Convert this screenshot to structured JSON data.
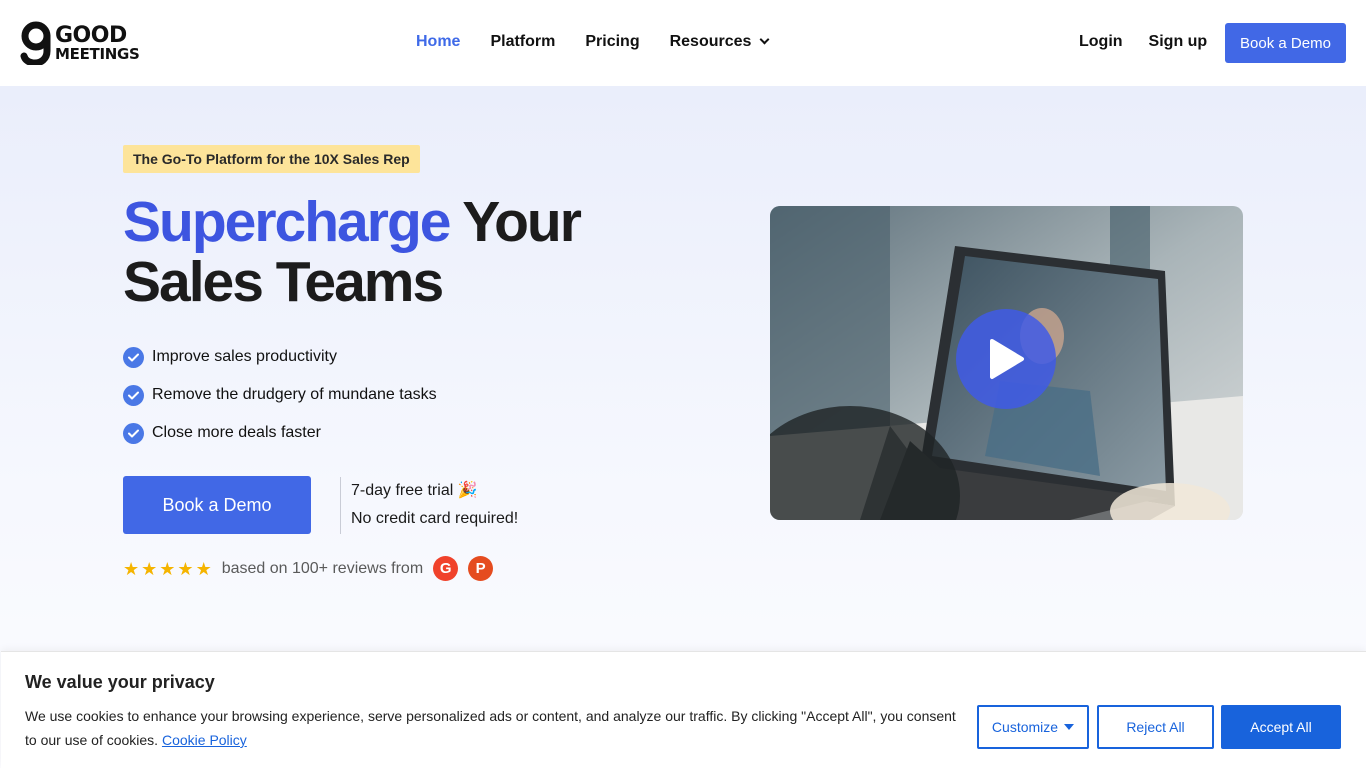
{
  "brand": {
    "logo_line1": "GOOD",
    "logo_line2": "MEETINGS"
  },
  "nav": {
    "items": [
      {
        "label": "Home",
        "active": true
      },
      {
        "label": "Platform"
      },
      {
        "label": "Pricing"
      },
      {
        "label": "Resources",
        "icon": "chevron-down-icon"
      }
    ]
  },
  "auth": {
    "login": "Login",
    "signup": "Sign up",
    "demo": "Book a Demo"
  },
  "hero": {
    "tagline": "The Go-To Platform for the 10X Sales Rep",
    "headline_accent": "Supercharge",
    "headline_rest1": " Your",
    "headline_line2": "Sales Teams",
    "benefits": [
      "Improve sales productivity",
      "Remove the drudgery of mundane tasks",
      "Close more deals faster"
    ],
    "cta": "Book a Demo",
    "trial_line1": "7-day free trial 🎉",
    "trial_line2": "No credit card required!",
    "rating_stars": 5,
    "reviews_text": "based on 100+ reviews from",
    "review_badges": [
      "G",
      "P"
    ]
  },
  "cookie": {
    "title": "We value your privacy",
    "text": "We use cookies to enhance your browsing experience, serve personalized ads or content, and analyze our traffic. By clicking \"Accept All\", you consent to our use of cookies.",
    "policy_link": "Cookie Policy",
    "customize": "Customize",
    "reject": "Reject All",
    "accept": "Accept All"
  },
  "colors": {
    "accent": "#4168e6",
    "headline_accent": "#3d55e0",
    "tagline_bg": "#fde49a",
    "cookie_blue": "#1863dc",
    "star": "#f5b400"
  }
}
